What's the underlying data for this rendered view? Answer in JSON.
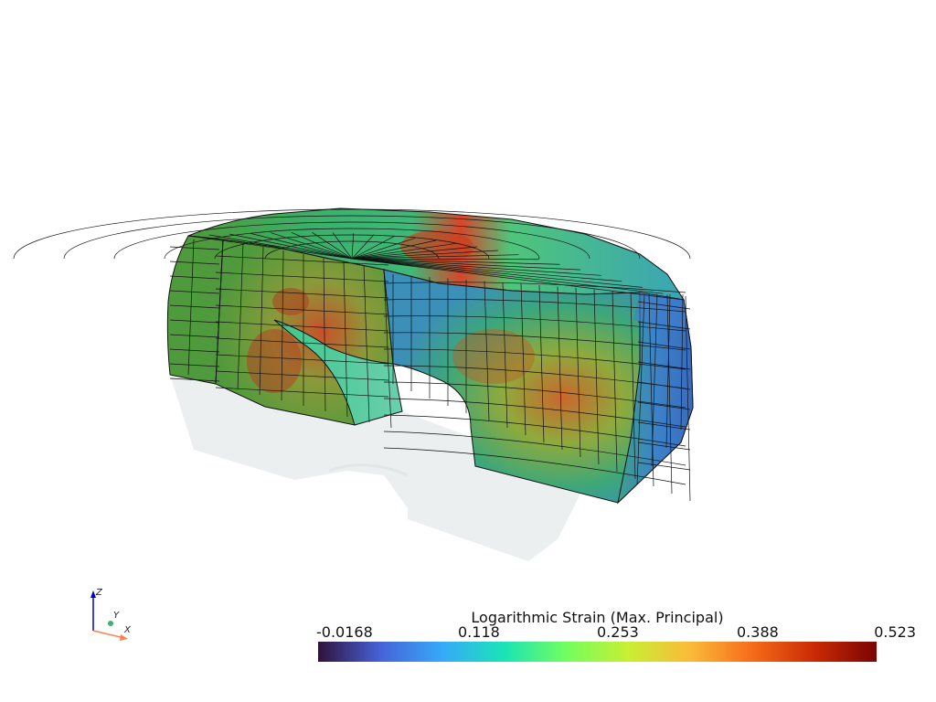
{
  "scalar_bar": {
    "title": "Logarithmic Strain (Max. Principal)",
    "ticks": [
      "-0.0168",
      "0.118",
      "0.253",
      "0.388",
      "0.523"
    ],
    "range": [
      -0.0168,
      0.523
    ],
    "colormap": [
      "#30123b",
      "#4662d7",
      "#36aaf9",
      "#1ae4b6",
      "#72fe5e",
      "#c8ef34",
      "#faba39",
      "#f66b19",
      "#ca2a04",
      "#7a0403"
    ]
  },
  "orientation_axes": {
    "x": "X",
    "y": "Y",
    "z": "Z",
    "x_color": "#ff7f50",
    "y_color": "#3cb371",
    "z_color": "#0000cd"
  },
  "mesh_color": "#111111",
  "ghost_color": "#e9eded"
}
